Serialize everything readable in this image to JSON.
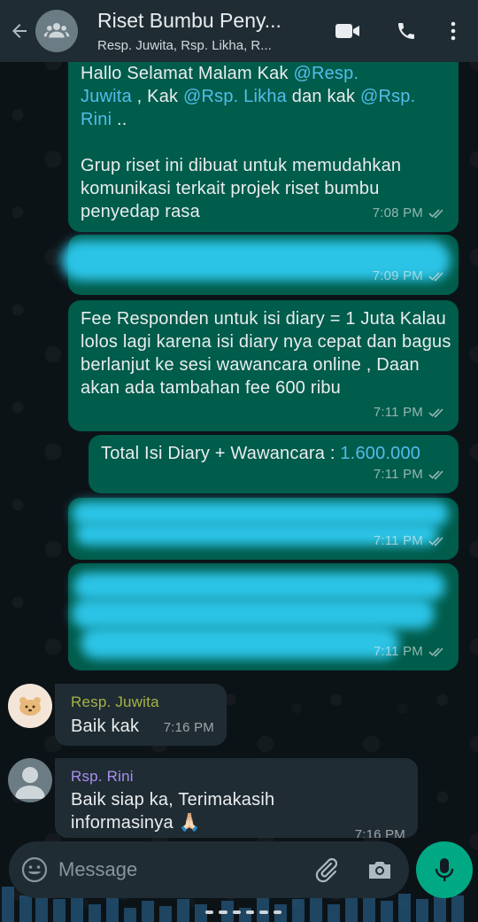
{
  "header": {
    "title": "Riset Bumbu Peny...",
    "subtitle": "Resp. Juwita, Rsp. Likha, R..."
  },
  "messages": {
    "m1": {
      "line1_a": "Hallo Selamat Malam Kak ",
      "line1_mention": "@Resp.",
      "line2_mention": "Juwita",
      "line2_a": " , Kak ",
      "line2_mention2": "@Rsp. Likha",
      "line2_b": "  dan kak ",
      "line2_mention3": "@Rsp.",
      "line3_mention": "Rini",
      "line3_a": " ..",
      "para2": "Grup riset ini dibuat untuk memudahkan komunikasi terkait projek riset bumbu penyedap rasa",
      "time": "7:08 PM"
    },
    "m2": {
      "time": "7:09 PM"
    },
    "m3": {
      "text": "Fee Responden untuk isi diary = 1 Juta Kalau lolos lagi karena isi diary nya cepat dan bagus berlanjut ke sesi wawancara online , Daan akan ada tambahan fee 600 ribu",
      "time": "7:11 PM"
    },
    "m4": {
      "text": "Total Isi Diary + Wawancara : ",
      "amount": "1.600.000",
      "time": "7:11 PM"
    },
    "m5": {
      "time": "7:11 PM"
    },
    "m6": {
      "time": "7:11 PM"
    },
    "m7": {
      "sender": "Resp. Juwita",
      "text": "Baik kak",
      "time": "7:16 PM"
    },
    "m8": {
      "sender": "Rsp. Rini",
      "text": "Baik siap ka, Terimakasih informasinya 🙏🏻",
      "time": "7:16 PM"
    }
  },
  "input": {
    "placeholder": "Message"
  },
  "colors": {
    "outgoing": "#005c4b",
    "incoming": "#202c33",
    "header": "#1f2c34",
    "accent": "#00a884",
    "mention": "#53bdeb",
    "sender_juwita": "#a6b246",
    "sender_rini": "#a791f2"
  },
  "icons": [
    "back-arrow-icon",
    "group-avatar-icon",
    "video-call-icon",
    "phone-call-icon",
    "more-options-icon",
    "emoji-icon",
    "attach-icon",
    "camera-icon",
    "mic-icon",
    "double-check-icon"
  ]
}
